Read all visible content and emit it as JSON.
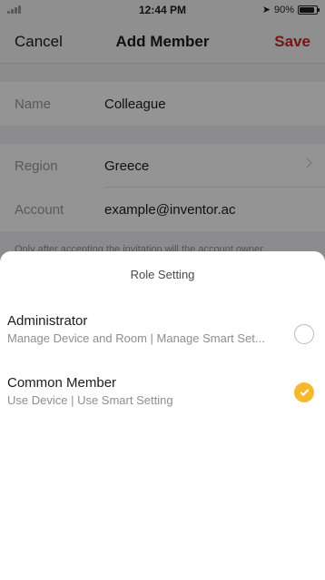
{
  "status_bar": {
    "time": "12:44 PM",
    "battery": "90%",
    "battery_level": 0.9
  },
  "nav": {
    "cancel_label": "Cancel",
    "title": "Add Member",
    "save_label": "Save"
  },
  "colors": {
    "save": "#c62828",
    "accent_check": "#f5b82e"
  },
  "form": {
    "name_label": "Name",
    "name_value": "Colleague",
    "region_label": "Region",
    "region_value": "Greece",
    "account_label": "Account",
    "account_value": "example@inventor.ac",
    "hint": "Only after accepting the invitation will the account owner..."
  },
  "role_sheet": {
    "title": "Role Setting",
    "options": [
      {
        "title": "Administrator",
        "description": "Manage Device and Room | Manage Smart Set...",
        "selected": false
      },
      {
        "title": "Common Member",
        "description": "Use Device | Use Smart Setting",
        "selected": true
      }
    ]
  }
}
